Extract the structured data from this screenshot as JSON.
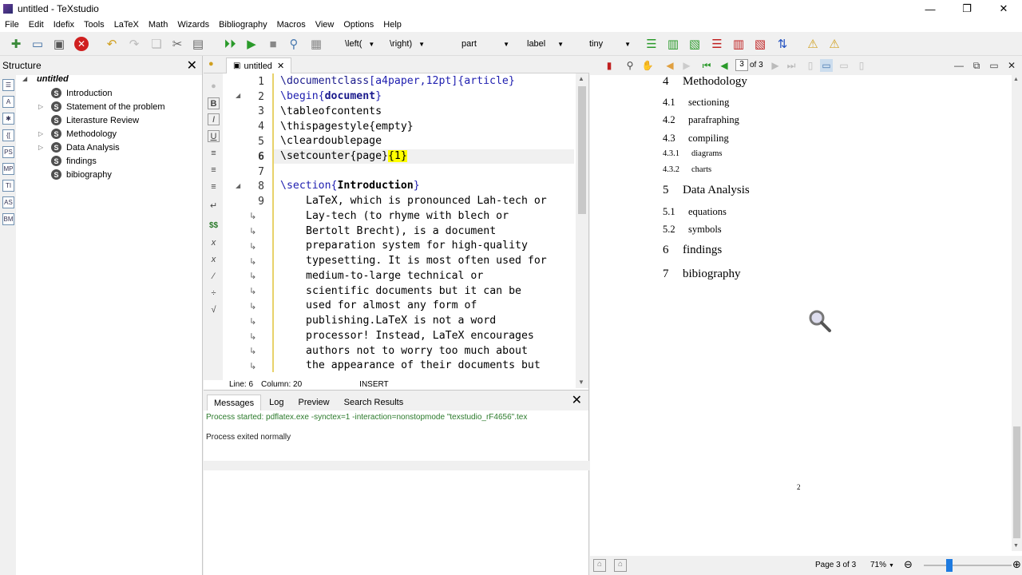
{
  "window": {
    "title": "untitled - TeXstudio",
    "minimize": "—",
    "restore": "❐",
    "close": "✕"
  },
  "menu": [
    "File",
    "Edit",
    "Idefix",
    "Tools",
    "LaTeX",
    "Math",
    "Wizards",
    "Bibliography",
    "Macros",
    "View",
    "Options",
    "Help"
  ],
  "toolbar": {
    "left_delim": "\\left(",
    "right_delim": "\\right)",
    "section_combo": "part",
    "label_combo": "label",
    "size_combo": "tiny"
  },
  "structure": {
    "title": "Structure",
    "close": "✕",
    "root": "untitled",
    "items": [
      {
        "label": "Introduction",
        "expandable": false
      },
      {
        "label": "Statement of the problem",
        "expandable": true
      },
      {
        "label": "Literasture Review",
        "expandable": false
      },
      {
        "label": "Methodology",
        "expandable": true
      },
      {
        "label": "Data Analysis",
        "expandable": true
      },
      {
        "label": "findings",
        "expandable": false
      },
      {
        "label": "bibiography",
        "expandable": false
      }
    ],
    "side_icons": [
      "B",
      "A",
      "✱",
      "{[",
      "PS",
      "MP",
      "TI",
      "AS",
      "BM"
    ]
  },
  "editor": {
    "tab_label": "untitled",
    "tab_close": "✕",
    "line_numbers": [
      "1",
      "2",
      "3",
      "4",
      "5",
      "6",
      "7",
      "8",
      "9"
    ],
    "current_line": "6",
    "wrap_mark": "↳",
    "status": {
      "line": "Line: 6",
      "column": "Column: 20",
      "mode": "INSERT"
    }
  },
  "code": {
    "l1a": "\\documentclass",
    "l1b": "[a4paper,12pt]{article}",
    "l2a": "\\begin{",
    "l2b": "document",
    "l2c": "}",
    "l3": "\\tableofcontents",
    "l4": "\\thispagestyle{empty}",
    "l5": "\\cleardoublepage",
    "l6a": "\\setcounter{page}",
    "l6b": "{1}",
    "l8a": "\\section{",
    "l8b": "Introduction",
    "l8c": "}",
    "wrapped": [
      "LaTeX, which is pronounced Lah-tech or",
      "Lay-tech (to rhyme with blech or",
      "Bertolt Brecht), is a document",
      "preparation system for high-quality",
      "typesetting. It is most often used for",
      "medium-to-large technical or",
      "scientific documents but it can be",
      "used for almost any form of",
      "publishing.LaTeX is not a word",
      "processor! Instead, LaTeX encourages",
      "authors not to worry too much about",
      "the appearance of their documents but"
    ]
  },
  "messages": {
    "tabs": [
      "Messages",
      "Log",
      "Preview",
      "Search Results"
    ],
    "close": "✕",
    "line1": "Process started: pdflatex.exe -synctex=1 -interaction=nonstopmode \"texstudio_rF4656\".tex",
    "line2": "Process exited normally"
  },
  "viewer": {
    "page_field": "3",
    "page_of": "of 3",
    "toc": [
      {
        "num": "4",
        "title": "Methodology",
        "level": "sec"
      },
      {
        "num": "4.1",
        "title": "sectioning",
        "level": "sub"
      },
      {
        "num": "4.2",
        "title": "parafraphing",
        "level": "sub"
      },
      {
        "num": "4.3",
        "title": "compiling",
        "level": "sub"
      },
      {
        "num": "4.3.1",
        "title": "diagrams",
        "level": "subsub"
      },
      {
        "num": "4.3.2",
        "title": "charts",
        "level": "subsub"
      },
      {
        "num": "5",
        "title": "Data Analysis",
        "level": "sec"
      },
      {
        "num": "5.1",
        "title": "equations",
        "level": "sub"
      },
      {
        "num": "5.2",
        "title": "symbols",
        "level": "sub"
      },
      {
        "num": "6",
        "title": "findings",
        "level": "sec"
      },
      {
        "num": "7",
        "title": "bibiography",
        "level": "sec"
      }
    ],
    "page_number": "2",
    "status_page": "Page 3 of 3",
    "zoom": "71%",
    "zoom_level_percent": 71
  }
}
